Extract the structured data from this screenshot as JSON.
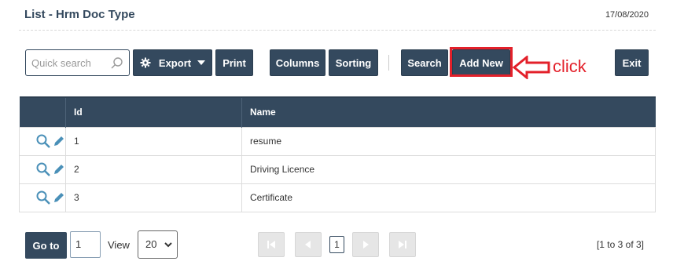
{
  "header": {
    "title": "List - Hrm Doc Type",
    "date": "17/08/2020"
  },
  "toolbar": {
    "search_placeholder": "Quick search",
    "export_label": "Export",
    "print_label": "Print",
    "columns_label": "Columns",
    "sorting_label": "Sorting",
    "search_label": "Search",
    "add_new_label": "Add New",
    "exit_label": "Exit"
  },
  "annotation": {
    "click_label": "click",
    "color": "#e3202a"
  },
  "table": {
    "columns": [
      "",
      "Id",
      "Name"
    ],
    "rows": [
      {
        "id": "1",
        "name": "resume"
      },
      {
        "id": "2",
        "name": "Driving Licence"
      },
      {
        "id": "3",
        "name": "Certificate"
      }
    ]
  },
  "pagination": {
    "goto_label": "Go to",
    "goto_value": "1",
    "view_label": "View",
    "view_value": "20",
    "current_page": "1",
    "range_text": "[1 to 3 of 3]"
  },
  "colors": {
    "primary": "#34495e",
    "icon": "#4a90b8"
  }
}
